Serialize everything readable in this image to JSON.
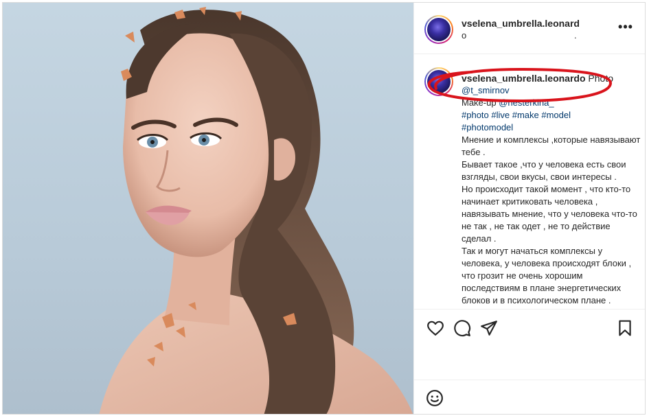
{
  "header": {
    "username": "vselena_umbrella.leonard",
    "subtitle": "o",
    "subtitle_dot": ".",
    "more_label": "•••"
  },
  "caption": {
    "username": "vselena_umbrella.leonardo",
    "head_word": "Photo",
    "photo_credit": "@t_smirnov",
    "makeup_label": "Make-up",
    "makeup_credit": "@nesterkina_",
    "hashtags_line1": "#photo #live #make #model",
    "hashtags_line2": "#photomodel",
    "text": "Мнение и комплексы ,которые навязывают тебе .\nБывает такое ,что у человека есть свои взгляды, свои вкусы, свои интересы .\nНо происходит такой момент , что кто-то начинает критиковать человека , навязывать мнение, что у человека что-то не так , не так одет , не то действие сделал .\nТак и могут начаться комплексы у человека, у человека происходят блоки , что грозит не очень хорошим последствиям в плане энергетических блоков и в психологическом плане ."
  },
  "actions": {
    "icons": [
      "heart-icon",
      "comment-icon",
      "share-icon",
      "bookmark-icon"
    ]
  },
  "comment_bar": {
    "icon": "emoji-icon"
  },
  "annotation": {
    "color": "#d9141c"
  }
}
